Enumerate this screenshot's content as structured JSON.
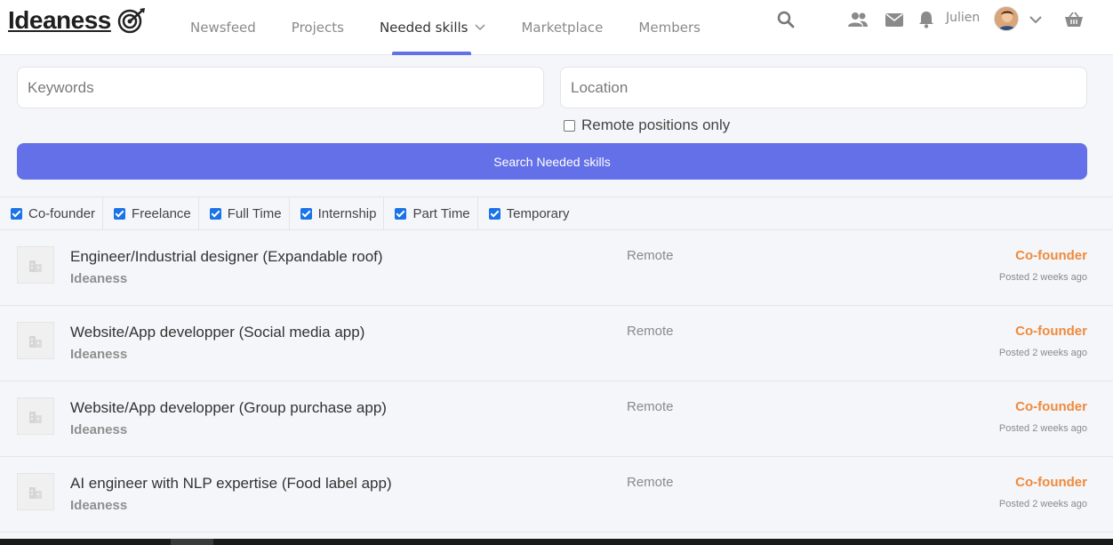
{
  "header": {
    "logo_text": "Ideaness",
    "nav": [
      {
        "label": "Newsfeed"
      },
      {
        "label": "Projects"
      },
      {
        "label": "Needed skills"
      },
      {
        "label": "Marketplace"
      },
      {
        "label": "Members"
      }
    ],
    "user_name": "Julien",
    "accent": "#6470e8"
  },
  "search": {
    "keywords_placeholder": "Keywords",
    "location_placeholder": "Location",
    "remote_label": "Remote positions only",
    "button_label": "Search Needed skills"
  },
  "filters": [
    {
      "label": "Co-founder",
      "checked": true
    },
    {
      "label": "Freelance",
      "checked": true
    },
    {
      "label": "Full Time",
      "checked": true
    },
    {
      "label": "Internship",
      "checked": true
    },
    {
      "label": "Part Time",
      "checked": true
    },
    {
      "label": "Temporary",
      "checked": true
    }
  ],
  "listings": [
    {
      "title": "Engineer/Industrial designer (Expandable roof)",
      "company": "Ideaness",
      "location": "Remote",
      "type": "Co-founder",
      "posted": "Posted 2 weeks ago"
    },
    {
      "title": "Website/App developper (Social media app)",
      "company": "Ideaness",
      "location": "Remote",
      "type": "Co-founder",
      "posted": "Posted 2 weeks ago"
    },
    {
      "title": "Website/App developper (Group purchase app)",
      "company": "Ideaness",
      "location": "Remote",
      "type": "Co-founder",
      "posted": "Posted 2 weeks ago"
    },
    {
      "title": "AI engineer with NLP expertise (Food label app)",
      "company": "Ideaness",
      "location": "Remote",
      "type": "Co-founder",
      "posted": "Posted 2 weeks ago"
    }
  ],
  "colors": {
    "type_color": "#f08a3c",
    "button": "#6470e8"
  }
}
